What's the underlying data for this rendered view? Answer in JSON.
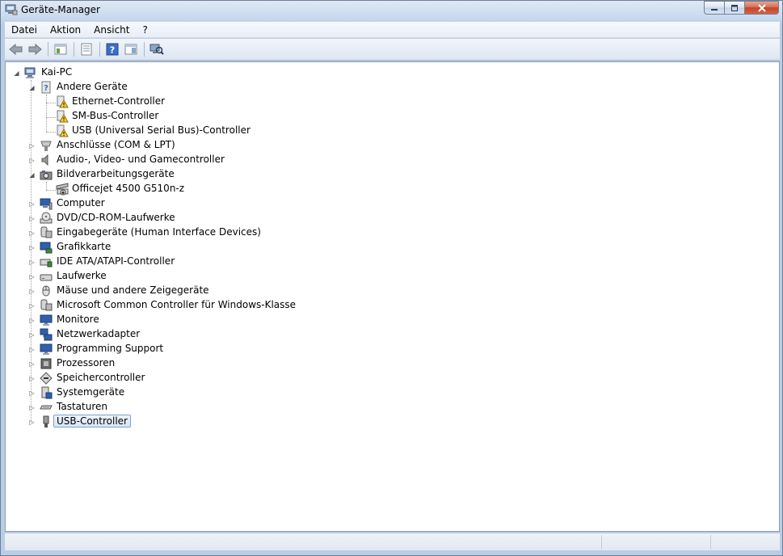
{
  "window": {
    "title": "Geräte-Manager",
    "controls": [
      "minimize",
      "maximize",
      "close"
    ]
  },
  "menu": {
    "items": [
      "Datei",
      "Aktion",
      "Ansicht",
      "?"
    ]
  },
  "toolbar": {
    "icons": [
      "back-arrow-icon",
      "forward-arrow-icon",
      "show-hide-console-tree-icon",
      "properties-icon",
      "help-icon",
      "show-action-pane-icon",
      "scan-hardware-icon"
    ]
  },
  "tree": {
    "root": "Kai-PC",
    "nodes": [
      {
        "label": "Andere Geräte",
        "expanded": true,
        "icon": "unknown-device-icon",
        "children": [
          {
            "label": "Ethernet-Controller",
            "icon": "warning-device-icon"
          },
          {
            "label": "SM-Bus-Controller",
            "icon": "warning-device-icon"
          },
          {
            "label": "USB (Universal Serial Bus)-Controller",
            "icon": "warning-device-icon"
          }
        ]
      },
      {
        "label": "Anschlüsse (COM & LPT)",
        "expanded": false,
        "icon": "port-icon"
      },
      {
        "label": "Audio-, Video- und Gamecontroller",
        "expanded": false,
        "icon": "speaker-icon"
      },
      {
        "label": "Bildverarbeitungsgeräte",
        "expanded": true,
        "icon": "camera-icon",
        "children": [
          {
            "label": "Officejet 4500 G510n-z",
            "icon": "scanner-download-icon"
          }
        ]
      },
      {
        "label": "Computer",
        "expanded": false,
        "icon": "computer-icon"
      },
      {
        "label": "DVD/CD-ROM-Laufwerke",
        "expanded": false,
        "icon": "dvd-drive-icon"
      },
      {
        "label": "Eingabegeräte (Human Interface Devices)",
        "expanded": false,
        "icon": "hid-icon"
      },
      {
        "label": "Grafikkarte",
        "expanded": false,
        "icon": "display-adapter-icon"
      },
      {
        "label": "IDE ATA/ATAPI-Controller",
        "expanded": false,
        "icon": "ide-controller-icon"
      },
      {
        "label": "Laufwerke",
        "expanded": false,
        "icon": "disk-drive-icon"
      },
      {
        "label": "Mäuse und andere Zeigegeräte",
        "expanded": false,
        "icon": "mouse-icon"
      },
      {
        "label": "Microsoft Common Controller für Windows-Klasse",
        "expanded": false,
        "icon": "hid-icon"
      },
      {
        "label": "Monitore",
        "expanded": false,
        "icon": "monitor-icon"
      },
      {
        "label": "Netzwerkadapter",
        "expanded": false,
        "icon": "network-adapter-icon"
      },
      {
        "label": "Programming Support",
        "expanded": false,
        "icon": "monitor-icon"
      },
      {
        "label": "Prozessoren",
        "expanded": false,
        "icon": "processor-icon"
      },
      {
        "label": "Speichercontroller",
        "expanded": false,
        "icon": "storage-controller-icon"
      },
      {
        "label": "Systemgeräte",
        "expanded": false,
        "icon": "system-device-icon"
      },
      {
        "label": "Tastaturen",
        "expanded": false,
        "icon": "keyboard-icon"
      },
      {
        "label": "USB-Controller",
        "expanded": false,
        "icon": "usb-icon",
        "selected": true
      }
    ]
  }
}
